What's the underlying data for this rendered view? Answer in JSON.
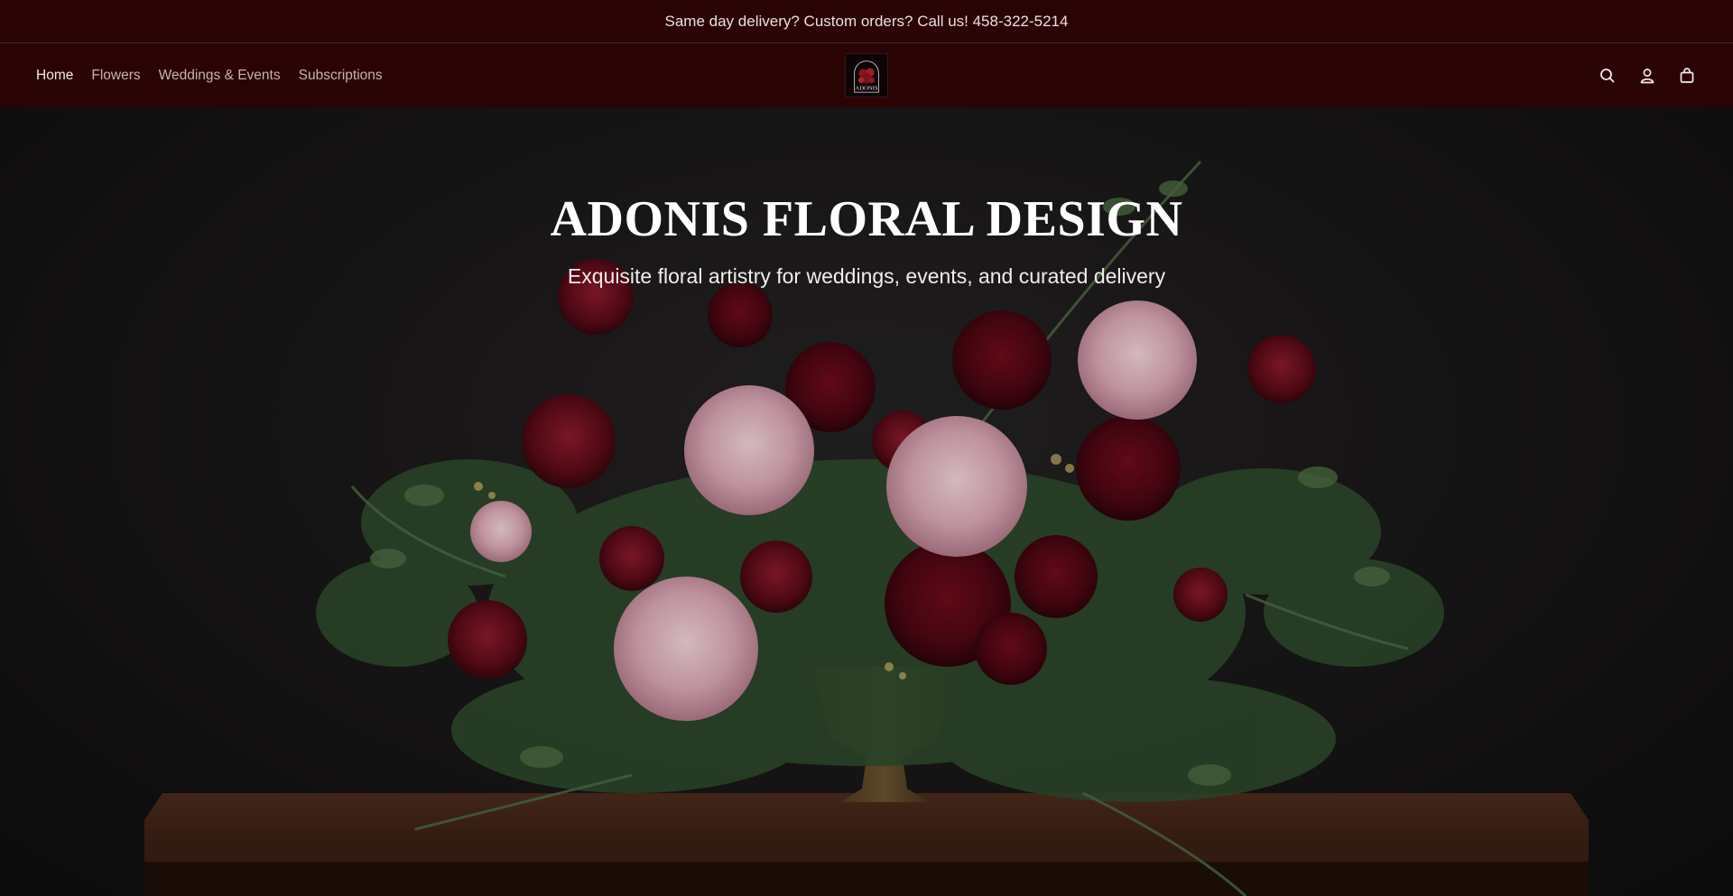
{
  "announcement": {
    "text": "Same day delivery? Custom orders? Call us! 458-322-5214"
  },
  "header": {
    "nav": [
      {
        "label": "Home",
        "active": true
      },
      {
        "label": "Flowers",
        "active": false
      },
      {
        "label": "Weddings & Events",
        "active": false
      },
      {
        "label": "Subscriptions",
        "active": false
      }
    ],
    "logo_text": "ADONIS",
    "icons": [
      "search-icon",
      "account-icon",
      "cart-icon"
    ]
  },
  "hero": {
    "title": "ADONIS FLORAL DESIGN",
    "subtitle": "Exquisite floral artistry for weddings, events, and curated delivery"
  },
  "colors": {
    "bar_background": "#2a0305",
    "hero_background": "#141212",
    "text_light": "#f2eaea"
  }
}
